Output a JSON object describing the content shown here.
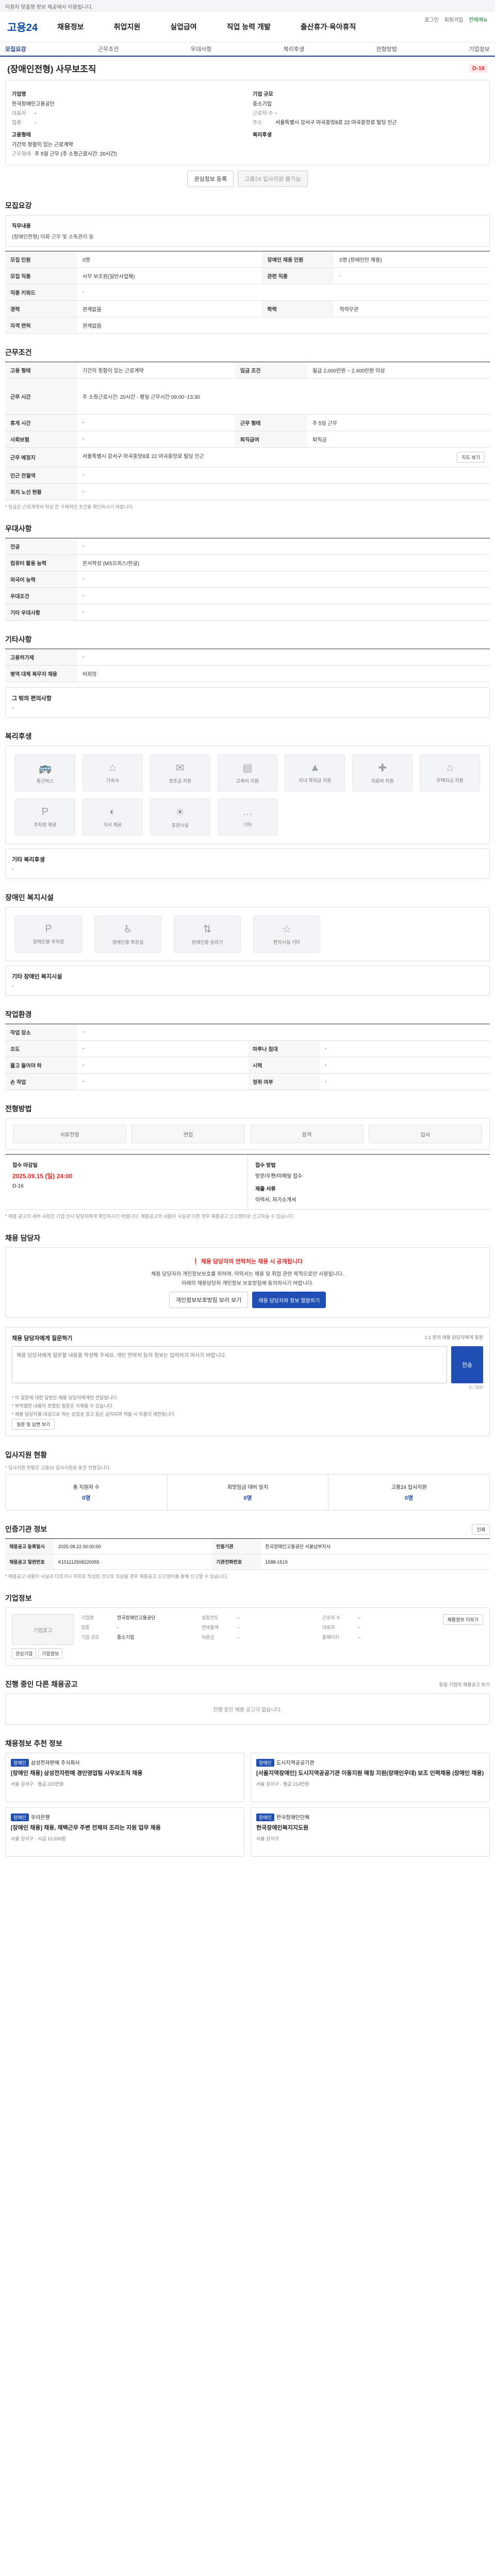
{
  "topbar": {
    "notice": "이용자 맞춤형 정보 제공에서 이용됩니다."
  },
  "header": {
    "logo": "고용24",
    "gnb": [
      "채용정보",
      "취업지원",
      "실업급여",
      "직업 능력 개발",
      "출산휴가·육아휴직"
    ],
    "links": [
      "로그인",
      "회원가입",
      "전체메뉴"
    ]
  },
  "tabs": [
    "모집요강",
    "근무조건",
    "우대사항",
    "복리후생",
    "전형방법",
    "기업정보"
  ],
  "job": {
    "title": "(장애인전형) 사무보조직",
    "dday": "D-16",
    "company_label": "기업명",
    "company_name": "한국장애인고용공단",
    "ceo_label": "대표자",
    "ceo": "-",
    "industry_label": "업종",
    "industry": "-",
    "address_label": "주소",
    "address": "서울특별시 강서구 마곡중앙8로 22 마곡중앙로 빌딩 인근",
    "size_label": "기업 규모",
    "size": "중소기업",
    "staff_label": "근로자 수",
    "staff": "-",
    "section_kind_label": "고용형태",
    "section_kind": "기간의 정함이 있는 근로계약",
    "work_label": "근무형태",
    "work": "주 5일 근무 (주 소정근로시간: 20시간)",
    "welfare_label": "복리후생"
  },
  "actions": {
    "scrap": "관심정보 등록",
    "apply_disabled": "고용24 입사지원 불가능"
  },
  "recruit": {
    "heading": "모집요강",
    "jobcontent_label": "직무내용",
    "jobcontent": "(장애인전형) 미화 근무 및 소독관리 등",
    "rows": [
      {
        "k": "모집 인원",
        "v": "0명",
        "k2": "장애인 채용 인원",
        "v2": "0명 (장애인만 채용)"
      },
      {
        "k": "모집 직종",
        "v": "사무 보조원(일반사업체)",
        "k2": "관련 직종",
        "v2": "-"
      },
      {
        "k": "직종 키워드",
        "v": "-",
        "k2": "",
        "v2": ""
      },
      {
        "k": "경력",
        "v": "관계없음",
        "k2": "학력",
        "v2": "학력무관"
      },
      {
        "k": "자격 면허",
        "v": "관계없음",
        "k2": "",
        "v2": ""
      }
    ]
  },
  "conditions": {
    "heading": "근무조건",
    "rows": [
      {
        "k": "고용 형태",
        "v": "기간의 정함이 있는 근로계약",
        "k2": "임금 조건",
        "v2": "월급 2,000만원 ~ 2,400만원 이상"
      },
      {
        "k": "근무 시간",
        "v": "주 소정근로시간: 20시간 · 평일 근무시간 09:00~13:30",
        "k2": "",
        "v2": ""
      },
      {
        "k": "휴게 시간",
        "v": "-",
        "k2": "근무 형태",
        "v2": "주 5일 근무"
      },
      {
        "k": "사회보험",
        "v": "-",
        "k2": "퇴직급여",
        "v2": "퇴직금"
      },
      {
        "k": "근무 예정지",
        "v": "서울특별시 강서구 마곡중앙8로 22 마곡중앙로 빌딩 인근",
        "k2": "",
        "v2": ""
      },
      {
        "k": "인근 전철역",
        "v": "-",
        "k2": "",
        "v2": ""
      },
      {
        "k": "최저 노선 현황",
        "v": "-",
        "k2": "",
        "v2": ""
      }
    ],
    "map_button": "지도 보기",
    "note": "* 임금은 근로계약서 작성 전 구체적인 조건을 확인하시기 바랍니다."
  },
  "preference": {
    "heading": "우대사항",
    "rows": [
      {
        "k": "전공",
        "v": "-"
      },
      {
        "k": "컴퓨터 활용 능력",
        "v": "문서작성 (MS오피스/한글)"
      },
      {
        "k": "외국어 능력",
        "v": "-"
      },
      {
        "k": "우대조건",
        "v": "-"
      },
      {
        "k": "기타 우대사항",
        "v": "-"
      }
    ]
  },
  "etc": {
    "heading": "기타사항",
    "rows": [
      {
        "k": "고용허가제",
        "v": "-"
      },
      {
        "k": "병역 대체 복무자 채용",
        "v": "비희망"
      }
    ],
    "disabled_heading": "그 밖의 편의사항",
    "disabled_value": "-"
  },
  "welfare": {
    "heading": "복리후생",
    "items": [
      "통근버스",
      "기숙사",
      "경조금 지원",
      "교육비 지원",
      "자녀 학자금 지원",
      "의료비 지원",
      "주택자금 지원",
      "주차장 제공",
      "식사 제공",
      "휴양시설",
      "기타"
    ],
    "other_label": "기타 복리후생",
    "other_value": "-"
  },
  "disabled_facility": {
    "heading": "장애인 복지시설",
    "items": [
      "장애인용 주차장",
      "장애인용 화장실",
      "장애인용 승강기",
      "편의시설 기타"
    ],
    "other_label": "기타 장애인 복지시설",
    "other_value": "-"
  },
  "worksite": {
    "heading": "작업환경",
    "rows": [
      {
        "k": "작업 장소",
        "v": "-",
        "k2": "",
        "v2": ""
      },
      {
        "k": "조도",
        "v": "-",
        "k2": "마루나 침대",
        "v2": "-"
      },
      {
        "k": "물고 들어야 하",
        "v": "-",
        "k2": "시력",
        "v2": "-"
      },
      {
        "k": "손 작업",
        "v": "-",
        "k2": "청취 여부",
        "v2": "-"
      }
    ]
  },
  "process": {
    "heading": "전형방법",
    "steps": [
      "서류전형",
      "면접",
      "합격",
      "입사"
    ],
    "deadline_label": "접수 마감일",
    "deadline": "2025.09.15 (일) 24:00",
    "deadline_dday": "D-16",
    "method_label": "접수 방법",
    "method": "방문/우편/이메일 접수",
    "docs_label": "제출 서류",
    "docs": "이력서, 자기소개서",
    "note": "* 채용 공고의 세부 사항은 기업 인사 담당자에게 확인하시기 바랍니다. 채용공고의 내용이 사실과 다른 경우 채용공고 신고센터로 신고하실 수 있습니다."
  },
  "contact": {
    "heading": "채용 담당자",
    "warn": "채용 담당자의 연락처는 채용 시 공개됩니다",
    "desc1": "채용 담당자의 개인정보보호를 위하여, 이력서는 채용 및 취업 관련 목적으로만 사용됩니다.",
    "desc2": "아래의 채용담당자 개인정보 보호방침에 동의하시기 바랍니다.",
    "btn1": "개인정보보호방침 보러 보기",
    "btn2": "채용 담당자와 정보 열람하기"
  },
  "inquiry": {
    "heading": "채용 담당자에게 질문하기",
    "right": "1:1 문의 채용 담당자에게 질문",
    "placeholder": "채용 담당자에게 질문할 내용을 작성해 주세요. 개인 연락처 등의 정보는 입력하지 마시기 바랍니다.",
    "counter": "0 / 500",
    "send": "전송",
    "bullets": [
      "* 이 질문에 대한 답변은 채용 담당자에게만 전달됩니다.",
      "* 부적절한 내용이 포함된 질문은 삭제될 수 있습니다.",
      "* 채용 담당자를 대상으로 하는 상업성 광고 등은 금지되며 적발 시 이용이 제한됩니다."
    ],
    "link": "질문 및 답변 보기"
  },
  "stats": {
    "heading": "입사지원 현황",
    "note": "* 입사지원 현황은 고용24 입사지원을 통한 현황입니다.",
    "items": [
      {
        "k": "총 지원자 수",
        "v": "0명"
      },
      {
        "k": "희망임금 대비 일치",
        "v": "0명"
      },
      {
        "k": "고용24 입사지원",
        "v": "0명"
      }
    ]
  },
  "agency": {
    "heading": "인증기관 정보",
    "print": "인쇄",
    "rows": [
      {
        "k": "채용공고 등록일시",
        "v": "2025.08.22 00:00:00",
        "k2": "인증기관",
        "v2": "한국장애인고용공단 서울남부지사"
      },
      {
        "k": "채용공고 일련번호",
        "v": "K151112508220055",
        "k2": "기관전화번호",
        "v2": "1588-1519"
      }
    ],
    "note": "* 채용공고 내용이 사실과 다르거나 허위로 작성된 것으로 의심될 경우 채용공고 신고센터를 통해 신고할 수 있습니다."
  },
  "companyinfo": {
    "heading": "기업정보",
    "logo_alt": "기업로고",
    "btn_a": "관심기업",
    "btn_b": "기업정보",
    "items": [
      {
        "k": "기업명",
        "v": "한국장애인고용공단"
      },
      {
        "k": "설립연도",
        "v": "-"
      },
      {
        "k": "근로자 수",
        "v": "-"
      },
      {
        "k": "업종",
        "v": "-"
      },
      {
        "k": "연매출액",
        "v": "-"
      },
      {
        "k": "대표자",
        "v": "-"
      },
      {
        "k": "기업 규모",
        "v": "중소기업"
      },
      {
        "k": "자본금",
        "v": "-"
      },
      {
        "k": "홈페이지",
        "v": "-"
      }
    ],
    "more": "채용정보 더보기"
  },
  "samecompany": {
    "heading": "진행 중인 다른 채용공고",
    "right": "동일 기업의 채용공고 보기",
    "empty": "진행 중인 채용 공고가 없습니다."
  },
  "recommend": {
    "heading": "채용정보 추천 정보",
    "jobs": [
      {
        "badge": "장애인",
        "company": "삼성전자판매 주식회사",
        "title": "[장애인 채용] 삼성전자판매 경인영업팀 사무보조직 채용",
        "meta": "서울 강서구 · 월급 220만원"
      },
      {
        "badge": "장애인",
        "company": "도시지역공공기관",
        "title": "[서울지역장애인] 도시지역공공기관 이동지원 매칭 지원(장애인우대) 보조 인력채용 (장애인 채용)",
        "meta": "서울 강서구 · 월급 214만원"
      },
      {
        "badge": "장애인",
        "company": "우리은행",
        "title": "[장애인 채용] 채용, 채택근무 주변 전체의 조리는 지원 업무 채용",
        "meta": "서울 강서구 · 시급 10,030원"
      },
      {
        "badge": "장애인",
        "company": "한국장애인단체",
        "title": "한국장애인복지지도원",
        "meta": "서울 강서구"
      }
    ]
  }
}
